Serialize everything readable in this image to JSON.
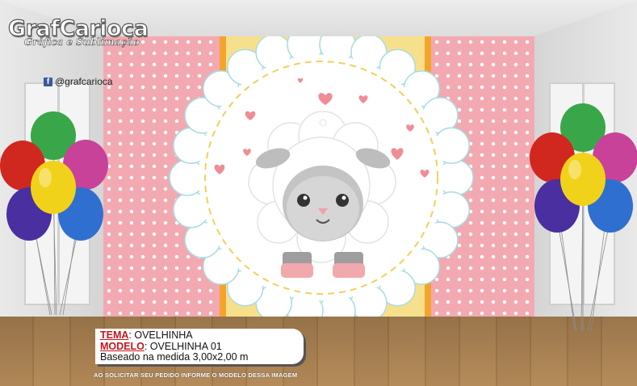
{
  "logo": {
    "title": "GrafCarioca",
    "subtitle": "Gráfica e Sublimação",
    "social_handle": "@grafcarioca",
    "social_icon": "facebook-icon"
  },
  "product": {
    "tema_label": "TEMA",
    "tema_value": ": OVELHINHA",
    "modelo_label": "MODELO",
    "modelo_value": ": OVELHINHA 01",
    "measure": "Baseado na medida 3,00x2,00 m"
  },
  "notice": "AO SOLICITAR SEU PEDIDO INFORME O MODELO DESSA IMAGEM",
  "colors": {
    "pink": "#f3a9b1",
    "yellow": "#f7e08c",
    "orange": "#f2a42c",
    "accent_red": "#c4161c"
  }
}
